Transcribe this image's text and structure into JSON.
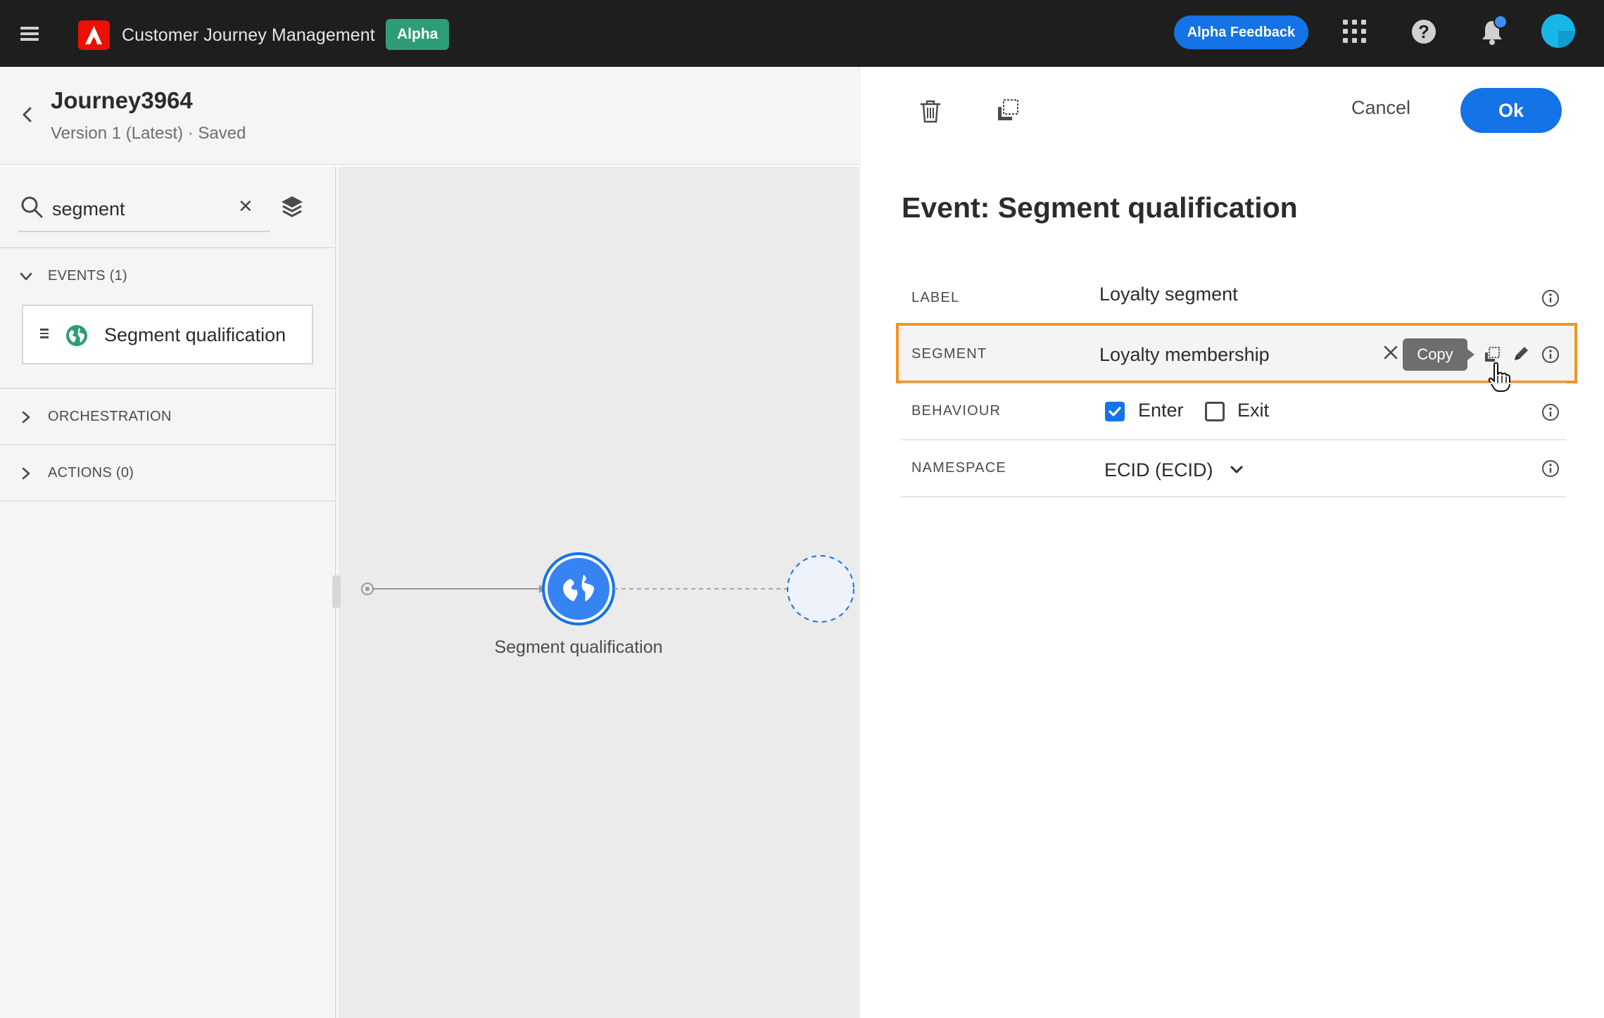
{
  "header": {
    "app_name": "Customer Journey Management",
    "badge": "Alpha",
    "feedback_button": "Alpha Feedback",
    "icons": [
      "menu-icon",
      "adobe-logo",
      "apps-grid-icon",
      "help-icon",
      "bell-icon",
      "avatar"
    ],
    "help_glyph": "?",
    "colors": {
      "bar": "#1e1e1e",
      "badge": "#2d9d78",
      "feedback": "#1473e6",
      "logo": "#eb1000"
    }
  },
  "journey": {
    "title": "Journey3964",
    "version": "Version 1 (Latest) · Saved"
  },
  "palette": {
    "search_value": "segment",
    "clear_glyph": "✕",
    "sections": [
      {
        "label": "EVENTS (1)",
        "expanded": true
      },
      {
        "label": "ORCHESTRATION",
        "expanded": false
      },
      {
        "label": "ACTIONS (0)",
        "expanded": false
      }
    ],
    "event_item": "Segment qualification"
  },
  "canvas": {
    "node_label": "Segment qualification",
    "node_icon": "globe-icon"
  },
  "panel": {
    "cancel": "Cancel",
    "ok": "Ok",
    "title": "Event: Segment qualification",
    "fields": {
      "label": {
        "name": "LABEL",
        "value": "Loyalty segment"
      },
      "segment": {
        "name": "SEGMENT",
        "value": "Loyalty membership",
        "tooltip": "Copy"
      },
      "behaviour": {
        "name": "BEHAVIOUR",
        "options": [
          {
            "label": "Enter",
            "checked": true
          },
          {
            "label": "Exit",
            "checked": false
          }
        ]
      },
      "namespace": {
        "name": "NAMESPACE",
        "value": "ECID (ECID)"
      }
    },
    "colors": {
      "highlight": "#f29423",
      "accent": "#1473e6"
    }
  }
}
